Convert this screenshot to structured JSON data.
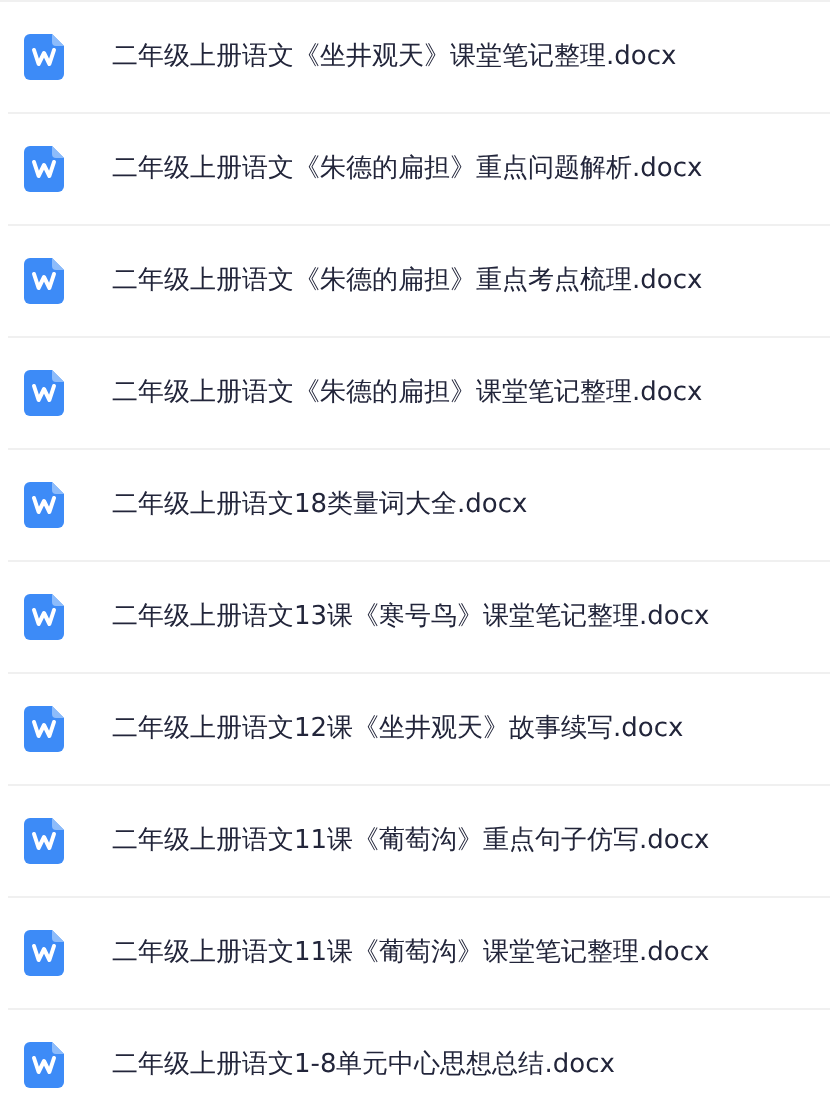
{
  "files": [
    {
      "name": "二年级上册语文《坐井观天》课堂笔记整理.docx",
      "kind": "word"
    },
    {
      "name": "二年级上册语文《朱德的扁担》重点问题解析.docx",
      "kind": "word"
    },
    {
      "name": "二年级上册语文《朱德的扁担》重点考点梳理.docx",
      "kind": "word"
    },
    {
      "name": "二年级上册语文《朱德的扁担》课堂笔记整理.docx",
      "kind": "word"
    },
    {
      "name": "二年级上册语文18类量词大全.docx",
      "kind": "word"
    },
    {
      "name": "二年级上册语文13课《寒号鸟》课堂笔记整理.docx",
      "kind": "word"
    },
    {
      "name": "二年级上册语文12课《坐井观天》故事续写.docx",
      "kind": "word"
    },
    {
      "name": "二年级上册语文11课《葡萄沟》重点句子仿写.docx",
      "kind": "word"
    },
    {
      "name": "二年级上册语文11课《葡萄沟》课堂笔记整理.docx",
      "kind": "word"
    },
    {
      "name": "二年级上册语文1-8单元中心思想总结.docx",
      "kind": "word"
    }
  ]
}
